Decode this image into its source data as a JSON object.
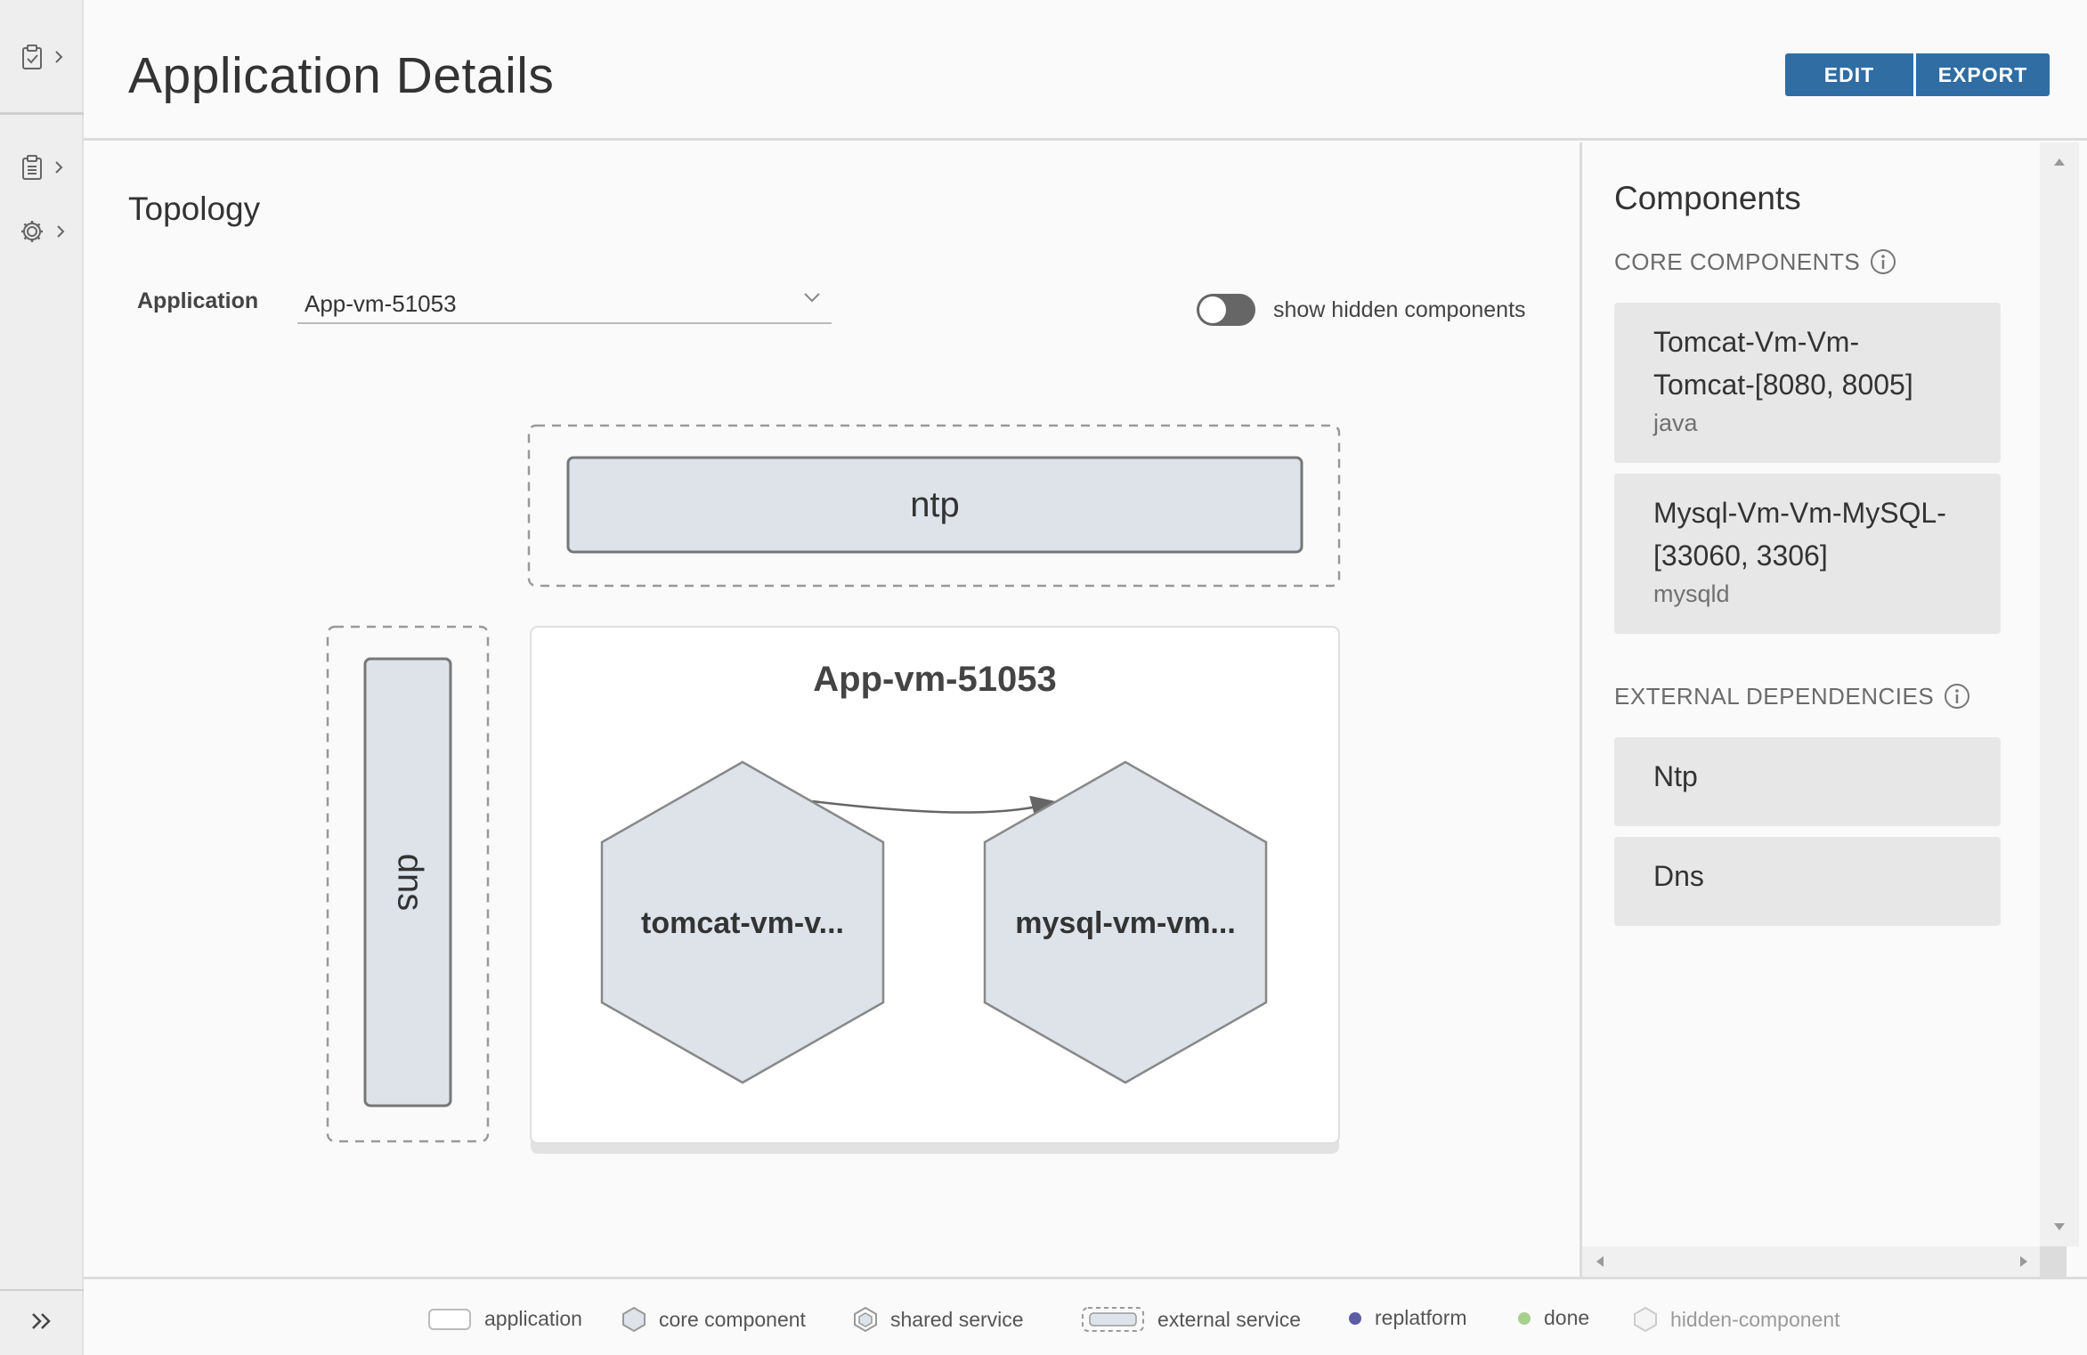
{
  "header": {
    "title": "Application Details",
    "edit_label": "EDIT",
    "export_label": "EXPORT"
  },
  "topology": {
    "title": "Topology",
    "application_label": "Application",
    "application_value": "App-vm-51053",
    "toggle_label": "show hidden components",
    "toggle_on": false,
    "external_top": "ntp",
    "external_left": "dns",
    "app_box_title": "App-vm-51053",
    "nodes": [
      "tomcat-vm-v...",
      "mysql-vm-vm..."
    ]
  },
  "components": {
    "title": "Components",
    "core_title": "CORE COMPONENTS",
    "core": [
      {
        "name": "Tomcat-Vm-Vm-Tomcat-[8080, 8005]",
        "line1": "Tomcat-Vm-Vm-",
        "line2": "Tomcat-[8080, 8005]",
        "sub": "java"
      },
      {
        "name": "Mysql-Vm-Vm-MySQL-[33060, 3306]",
        "line1": "Mysql-Vm-Vm-MySQL-",
        "line2": "[33060, 3306]",
        "sub": "mysqld"
      }
    ],
    "external_title": "EXTERNAL DEPENDENCIES",
    "external": [
      {
        "name": "Ntp"
      },
      {
        "name": "Dns"
      }
    ]
  },
  "legend": [
    {
      "label": "application"
    },
    {
      "label": "core component"
    },
    {
      "label": "shared service"
    },
    {
      "label": "external service"
    },
    {
      "label": "replatform",
      "color": "#5b5ea6"
    },
    {
      "label": "done",
      "color": "#a8d08d"
    },
    {
      "label": "hidden-component"
    }
  ],
  "colors": {
    "primary_button": "#2f6da3",
    "node_fill": "#dde3e8",
    "card_bg": "#e7e7e7"
  }
}
